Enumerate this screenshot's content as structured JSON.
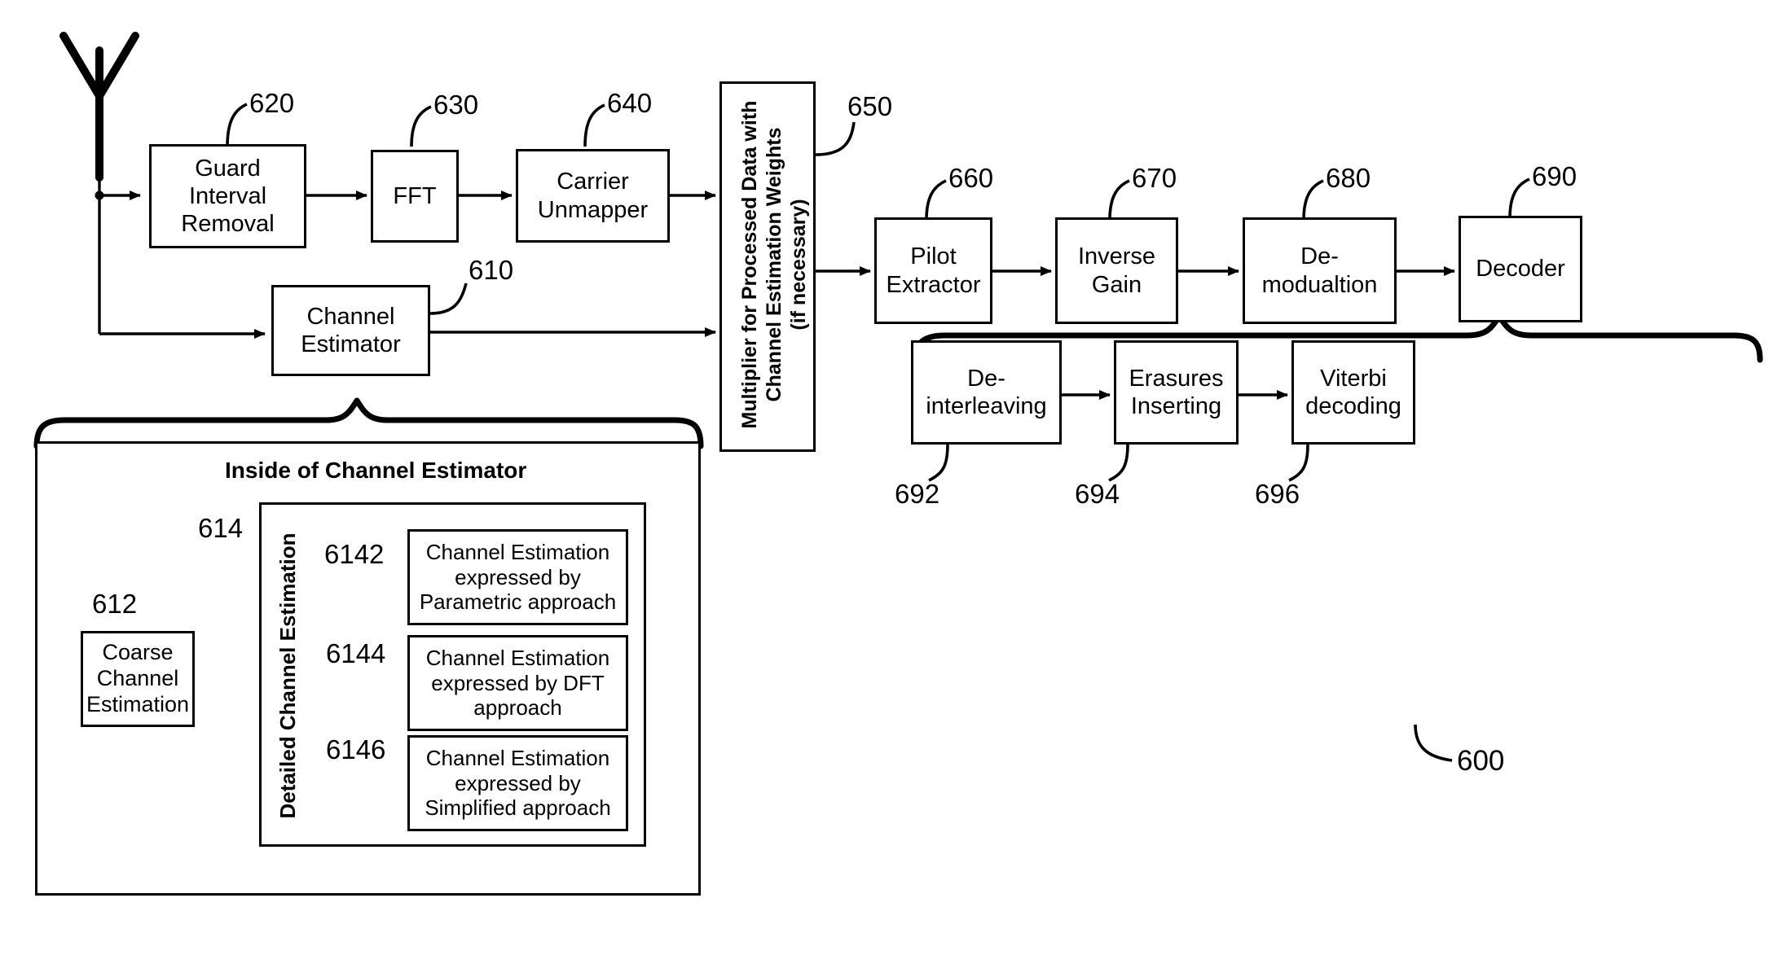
{
  "figure": {
    "reference_numeral": "600",
    "antenna_label": "antenna",
    "panel_title": "Inside of Channel Estimator"
  },
  "main_chain": [
    {
      "id": "guard",
      "ref": "620",
      "label": "Guard\nInterval\nRemoval"
    },
    {
      "id": "fft",
      "ref": "630",
      "label": "FFT"
    },
    {
      "id": "unmapper",
      "ref": "640",
      "label": "Carrier\nUnmapper"
    },
    {
      "id": "multiplier",
      "ref": "650",
      "label": "Multiplier for Processed Data with\nChannel Estimation Weights\n(if necessary)"
    },
    {
      "id": "pilot",
      "ref": "660",
      "label": "Pilot\nExtractor"
    },
    {
      "id": "gain",
      "ref": "670",
      "label": "Inverse\nGain"
    },
    {
      "id": "demod",
      "ref": "680",
      "label": "De-\nmodualtion"
    },
    {
      "id": "decoder",
      "ref": "690",
      "label": "Decoder"
    }
  ],
  "channel_estimator": {
    "ref": "610",
    "label": "Channel\nEstimator"
  },
  "decoder_detail": [
    {
      "id": "deinterleave",
      "ref": "692",
      "label": "De-\ninterleaving"
    },
    {
      "id": "erasures",
      "ref": "694",
      "label": "Erasures\nInserting"
    },
    {
      "id": "viterbi",
      "ref": "696",
      "label": "Viterbi\ndecoding"
    }
  ],
  "estimator_detail": {
    "coarse": {
      "ref": "612",
      "label": "Coarse\nChannel\nEstimation"
    },
    "detailed_group": {
      "ref": "614",
      "label": "Detailed Channel Estimation"
    },
    "approaches": [
      {
        "ref": "6142",
        "label": "Channel Estimation\nexpressed by\nParametric approach"
      },
      {
        "ref": "6144",
        "label": "Channel Estimation\nexpressed by DFT\napproach"
      },
      {
        "ref": "6146",
        "label": "Channel Estimation\nexpressed by\nSimplified approach"
      }
    ]
  },
  "colors": {
    "ink": "#000000",
    "paper": "#ffffff"
  }
}
